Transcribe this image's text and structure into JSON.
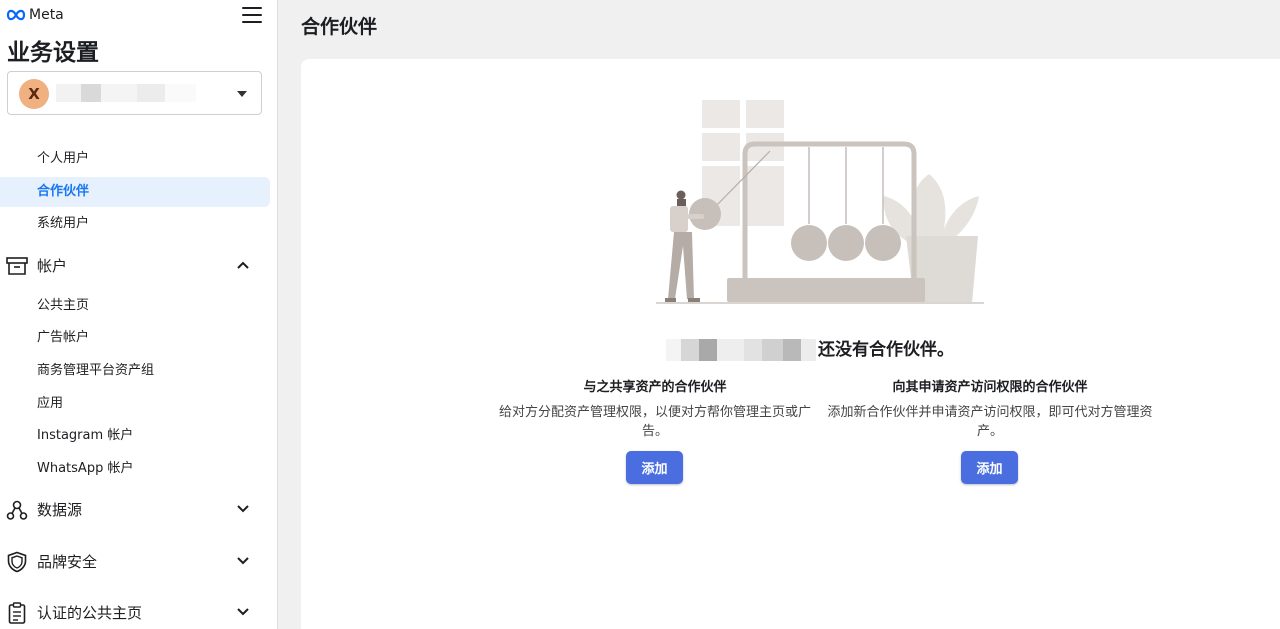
{
  "brand": {
    "logo_text": "Meta",
    "accent": "#1877f2",
    "button_color": "#4a6ee0"
  },
  "sidebar": {
    "title": "业务设置",
    "business_selector": {
      "avatar_letter": "X"
    },
    "user_items": [
      {
        "label": "个人用户",
        "active": false
      },
      {
        "label": "合作伙伴",
        "active": true
      },
      {
        "label": "系统用户",
        "active": false
      }
    ],
    "sections": [
      {
        "label": "帐户",
        "icon": "archive-box-icon",
        "expanded": true,
        "items": [
          "公共主页",
          "广告帐户",
          "商务管理平台资产组",
          "应用",
          "Instagram 帐户",
          "WhatsApp 帐户"
        ]
      },
      {
        "label": "数据源",
        "icon": "data-sources-icon",
        "expanded": false
      },
      {
        "label": "品牌安全",
        "icon": "shield-icon",
        "expanded": false
      },
      {
        "label": "认证的公共主页",
        "icon": "clipboard-icon",
        "expanded": false
      }
    ]
  },
  "main": {
    "title": "合作伙伴",
    "empty_state": {
      "message": "还没有合作伙伴。",
      "columns": [
        {
          "heading": "与之共享资产的合作伙伴",
          "description": "给对方分配资产管理权限，以便对方帮你管理主页或广告。",
          "button_label": "添加"
        },
        {
          "heading": "向其申请资产访问权限的合作伙伴",
          "description": "添加新合作伙伴并申请资产访问权限，即可代对方管理资产。",
          "button_label": "添加"
        }
      ]
    }
  }
}
